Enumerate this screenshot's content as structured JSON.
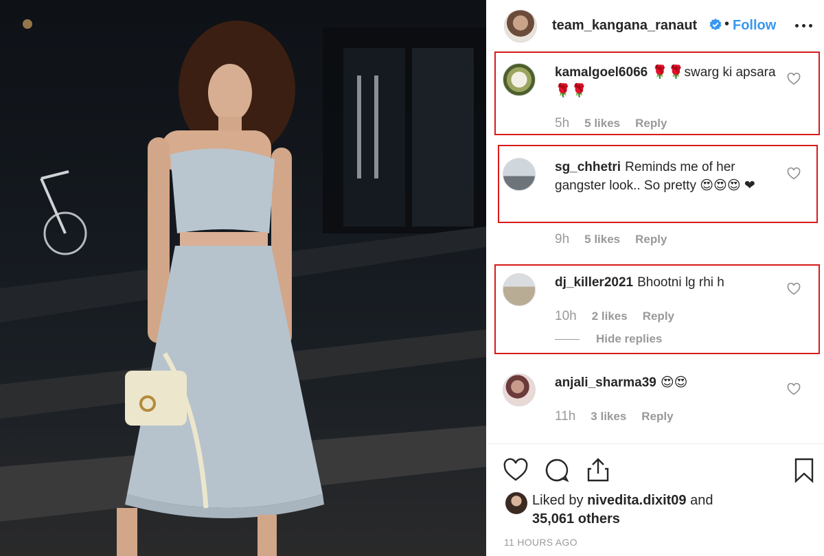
{
  "post": {
    "username": "team_kangana_ranaut",
    "separator": "•",
    "follow_label": "Follow",
    "more_icon": "more-options-icon",
    "verified_icon": "verified-badge-icon",
    "accent_color": "#3897f0"
  },
  "comments": [
    {
      "username": "kamalgoel6066",
      "text": "🌹🌹swarg ki apsara🌹🌹",
      "time": "5h",
      "likes": "5 likes",
      "reply": "Reply"
    },
    {
      "username": "sg_chhetri",
      "text": "Reminds me of her gangster look.. So pretty 😍😍😍 ❤",
      "time": "9h",
      "likes": "5 likes",
      "reply": "Reply"
    },
    {
      "username": "dj_killer2021",
      "text": "Bhootni lg rhi h",
      "time": "10h",
      "likes": "2 likes",
      "reply": "Reply"
    },
    {
      "username": "anjali_sharma39",
      "text": "😍😍",
      "time": "11h",
      "likes": "3 likes",
      "reply": "Reply"
    }
  ],
  "hide_replies_label": "Hide replies",
  "highlight_color": "#d71a1a",
  "likes": {
    "prefix": "Liked by",
    "user": "nivedita.dixit09",
    "conj": "and",
    "others": "35,061 others"
  },
  "timestamp": "11 HOURS AGO",
  "icons": {
    "like": "heart-icon",
    "comment": "comment-icon",
    "share": "share-icon",
    "save": "bookmark-icon"
  }
}
